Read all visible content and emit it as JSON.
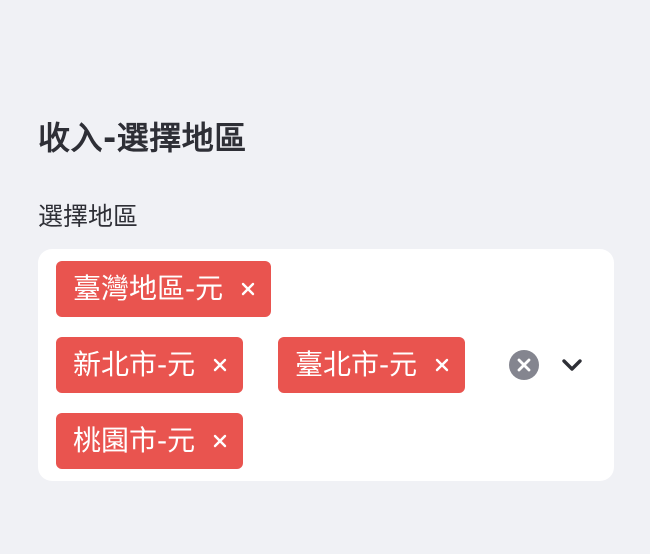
{
  "section": {
    "title": "收入-選擇地區"
  },
  "region_select": {
    "label": "選擇地區",
    "selected_tags": [
      {
        "label": "臺灣地區-元"
      },
      {
        "label": "新北市-元"
      },
      {
        "label": "臺北市-元"
      },
      {
        "label": "桃園市-元"
      }
    ],
    "tag_remove_icon": "close-icon",
    "clear_icon": "clear-circle-icon",
    "dropdown_icon": "chevron-down-icon"
  },
  "colors": {
    "background": "#f0f1f5",
    "tag": "#e9544f",
    "text": "#2e2f36",
    "clear_icon": "#84858f"
  }
}
